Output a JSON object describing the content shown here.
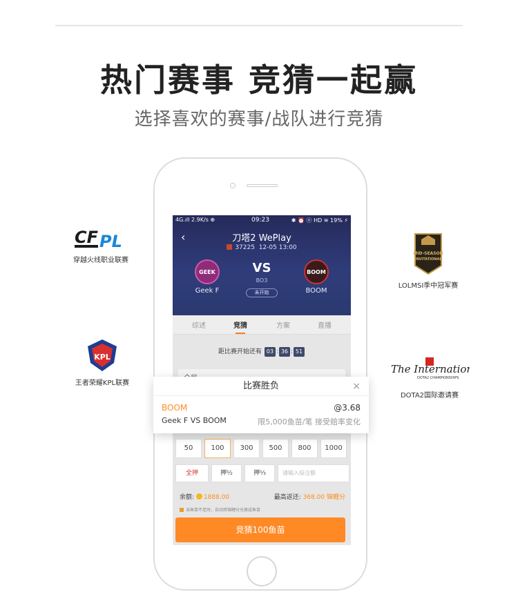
{
  "headline": "热门赛事  竞猜一起赢",
  "subhead": "选择喜欢的赛事/战队进行竞猜",
  "leagues": {
    "cfpl": "穿越火线职业联赛",
    "kpl": "王者荣耀KPL联赛",
    "lolmsi": "LOLMSI季中冠军赛",
    "dota2": "DOTA2国际邀请赛"
  },
  "statusbar": {
    "left": "4G.ıll 2.9K/s ⊕",
    "time": "09:23",
    "right": "✱ ⏰ ⓝ HD ≋ 19% ⚡"
  },
  "match": {
    "title": "刀塔2 WePlay",
    "id": "37225",
    "date": "12-05 13:00",
    "vs": "VS",
    "format": "BO3",
    "status": "未开始",
    "team_a": "Geek F",
    "team_a_badge": "GEEK",
    "team_b": "BOOM",
    "team_b_badge": "BOOM"
  },
  "tabs": [
    "综述",
    "竞猜",
    "方案",
    "直播"
  ],
  "countdown": {
    "label": "距比赛开始还有",
    "h": "03",
    "m": "36",
    "s": "51"
  },
  "round_label": "全局",
  "amounts": [
    "50",
    "100",
    "300",
    "500",
    "800",
    "1000"
  ],
  "options": {
    "all_in": "全押",
    "half": "押½",
    "third": "押⅓",
    "input_placeholder": "请输入投注额"
  },
  "balance": {
    "label": "余额:",
    "value": "1888.00",
    "max_label": "最高返还:",
    "max_value": "368.00 锦鲤分"
  },
  "note": "当鱼苗不足时，自动将锦鲤分兑换成鱼苗",
  "bet_button": "竞猜100鱼苗",
  "popup": {
    "title": "比赛胜负",
    "close": "×",
    "team": "BOOM",
    "odds": "@3.68",
    "match": "Geek F VS BOOM",
    "limit": "限5,000鱼苗/笔 接受赔率变化"
  },
  "colors": {
    "accent": "#ff8a25",
    "hero_bg": "#2b3a70"
  }
}
